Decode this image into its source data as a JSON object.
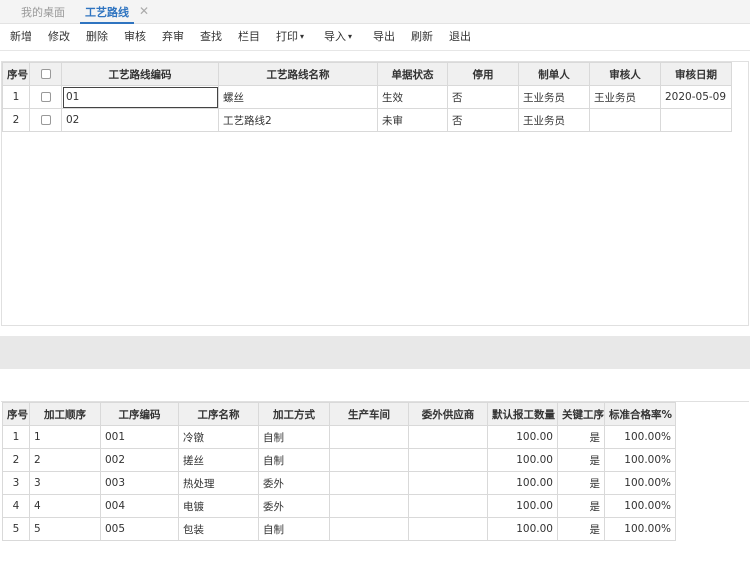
{
  "tabs": {
    "desktop": "我的桌面",
    "active": "工艺路线",
    "close": "✕"
  },
  "toolbar": {
    "add": "新增",
    "edit": "修改",
    "delete": "删除",
    "approve": "审核",
    "unapprove": "弃审",
    "find": "查找",
    "columns": "栏目",
    "print": "打印",
    "import": "导入",
    "export": "导出",
    "refresh": "刷新",
    "exit": "退出",
    "dropdown_caret": "▾"
  },
  "route_table": {
    "headers": {
      "seq": "序号",
      "code": "工艺路线编码",
      "name": "工艺路线名称",
      "status": "单据状态",
      "disabled": "停用",
      "creator": "制单人",
      "auditor": "审核人",
      "audit_date": "审核日期"
    },
    "rows": [
      {
        "seq": "1",
        "code": "01",
        "name": "螺丝",
        "status": "生效",
        "disabled": "否",
        "creator": "王业务员",
        "auditor": "王业务员",
        "audit_date": "2020-05-09"
      },
      {
        "seq": "2",
        "code": "02",
        "name": "工艺路线2",
        "status": "未审",
        "disabled": "否",
        "creator": "王业务员",
        "auditor": "",
        "audit_date": ""
      }
    ]
  },
  "process_table": {
    "headers": {
      "seq": "序号",
      "order": "加工顺序",
      "proc_code": "工序编码",
      "proc_name": "工序名称",
      "method": "加工方式",
      "workshop": "生产车间",
      "supplier": "委外供应商",
      "default_qty": "默认报工数量",
      "key_proc": "关键工序",
      "pass_rate": "标准合格率%"
    },
    "rows": [
      {
        "seq": "1",
        "order": "1",
        "proc_code": "001",
        "proc_name": "冷镦",
        "method": "自制",
        "workshop": "",
        "supplier": "",
        "default_qty": "100.00",
        "key_proc": "是",
        "pass_rate": "100.00%"
      },
      {
        "seq": "2",
        "order": "2",
        "proc_code": "002",
        "proc_name": "搓丝",
        "method": "自制",
        "workshop": "",
        "supplier": "",
        "default_qty": "100.00",
        "key_proc": "是",
        "pass_rate": "100.00%"
      },
      {
        "seq": "3",
        "order": "3",
        "proc_code": "003",
        "proc_name": "热处理",
        "method": "委外",
        "workshop": "",
        "supplier": "",
        "default_qty": "100.00",
        "key_proc": "是",
        "pass_rate": "100.00%"
      },
      {
        "seq": "4",
        "order": "4",
        "proc_code": "004",
        "proc_name": "电镀",
        "method": "委外",
        "workshop": "",
        "supplier": "",
        "default_qty": "100.00",
        "key_proc": "是",
        "pass_rate": "100.00%"
      },
      {
        "seq": "5",
        "order": "5",
        "proc_code": "005",
        "proc_name": "包装",
        "method": "自制",
        "workshop": "",
        "supplier": "",
        "default_qty": "100.00",
        "key_proc": "是",
        "pass_rate": "100.00%"
      }
    ]
  },
  "colors": {
    "accent": "#2f74c0",
    "header_bg": "#f0f0f0",
    "divider_bg": "#e8e8e8"
  }
}
